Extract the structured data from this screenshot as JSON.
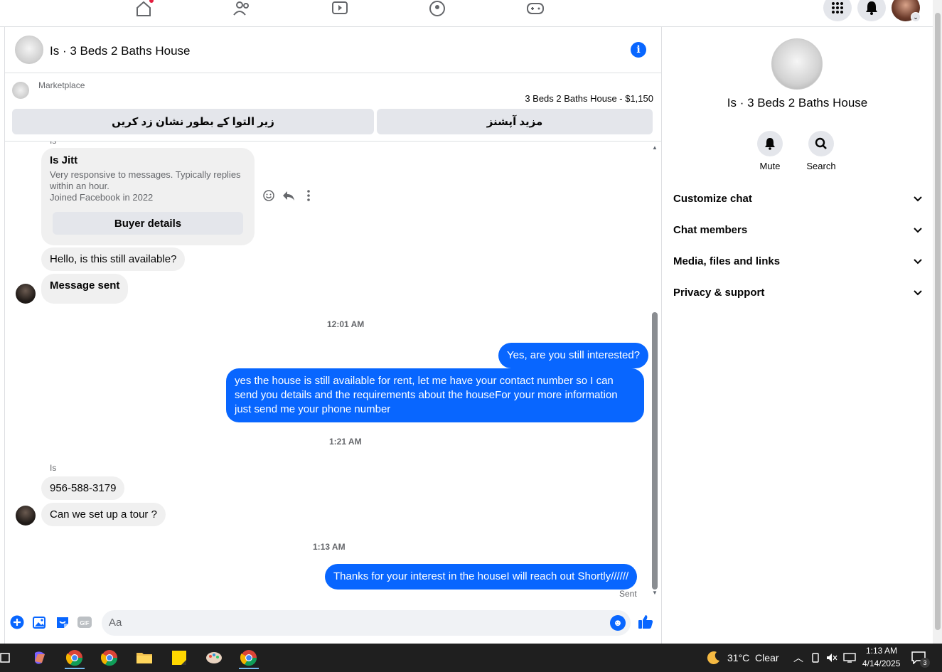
{
  "header": {
    "title": "Is · 3 Beds 2 Baths House"
  },
  "marketplace": {
    "label": "Marketplace",
    "listing_price": "3 Beds 2 Baths House - $1,150",
    "mark_button": "زیر التوا کے بطور نشان زد کریں",
    "more_button": "مزید آپشنز"
  },
  "card": {
    "name_label": "Is",
    "title": "Is Jitt",
    "description": "Very responsive to messages. Typically replies within an hour.",
    "joined": "Joined Facebook in 2022",
    "button": "Buyer details"
  },
  "messages": [
    {
      "text": "Hello, is this still available?"
    },
    {
      "text": "Message sent"
    },
    {
      "time": "12:01 AM"
    },
    {
      "text": "Yes, are you still interested?"
    },
    {
      "text": "yes the house is still available for rent, let me have your contact number so I can send you details and the requirements about the houseFor  your  more  information  just send  me   your  phone  number"
    },
    {
      "time": "1:21 AM"
    },
    {
      "sender": "Is"
    },
    {
      "text": "956-588-3179"
    },
    {
      "text": "Can we set up a tour ?"
    },
    {
      "time": "1:13 AM"
    },
    {
      "text": "Thanks for your interest in the houseI will reach out Shortly//////"
    },
    {
      "status": "Sent"
    }
  ],
  "composer": {
    "placeholder": "Aa",
    "gif_label": "GIF"
  },
  "info_panel": {
    "title": "Is · 3 Beds 2 Baths House",
    "mute_label": "Mute",
    "search_label": "Search",
    "rows": [
      "Customize chat",
      "Chat members",
      "Media, files and links",
      "Privacy & support"
    ]
  },
  "taskbar": {
    "weather": "31°C  Clear",
    "time": "1:13 AM",
    "date": "4/14/2025",
    "notification_count": "3"
  },
  "colors": {
    "accent": "#0866ff",
    "bubble_in": "#f0f0f0",
    "notification_red": "#e41e3f"
  }
}
